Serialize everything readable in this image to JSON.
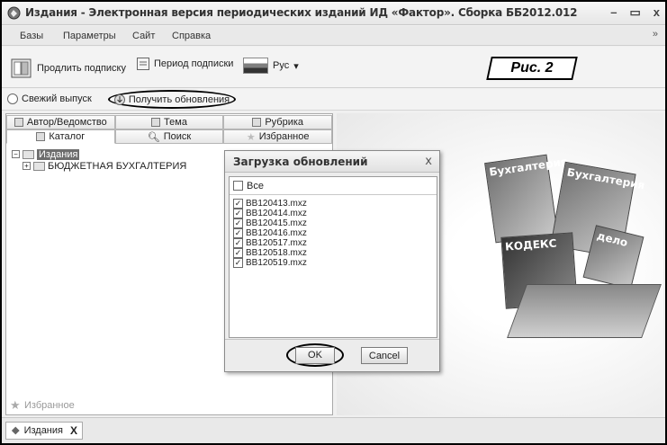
{
  "window": {
    "title": "Издания - Электронная версия периодических изданий ИД «Фактор». Сборка ББ2012.012",
    "controls": [
      "–",
      "▭",
      "x"
    ]
  },
  "menu": {
    "items": [
      "Базы",
      "Параметры",
      "Сайт",
      "Справка"
    ],
    "overflow": "»"
  },
  "toolbar": {
    "renew_subscription": "Продлить подписку",
    "subscription_period": "Период подписки",
    "language": "Рус",
    "language_arrow": "▾",
    "figure_label": "Рис. 2"
  },
  "subbar": {
    "fresh_issue": "Свежий выпуск",
    "get_updates": "Получить обновления"
  },
  "left_panel": {
    "tabs_row1": [
      "Автор/Ведомство",
      "Тема",
      "Рубрика"
    ],
    "tabs_row2": [
      "Каталог",
      "Поиск",
      "Избранное"
    ],
    "tree": {
      "root": "Издания",
      "child": "БЮДЖЕТНАЯ БУХГАЛТЕРИЯ"
    },
    "favorites_bottom": "Избранное"
  },
  "dialog": {
    "title": "Загрузка обновлений",
    "close": "x",
    "select_all": "Все",
    "files": [
      "BB120413.mxz",
      "BB120414.mxz",
      "BB120415.mxz",
      "BB120416.mxz",
      "BB120517.mxz",
      "BB120518.mxz",
      "BB120519.mxz"
    ],
    "ok": "OK",
    "cancel": "Cancel"
  },
  "promo": {
    "mag1": "Бухгалтерия",
    "mag2": "КОДЕКС",
    "mag3": "Бухгалтерия",
    "mag4": "дело"
  },
  "bottom_tabs": {
    "tab": "Издания",
    "close": "X"
  }
}
